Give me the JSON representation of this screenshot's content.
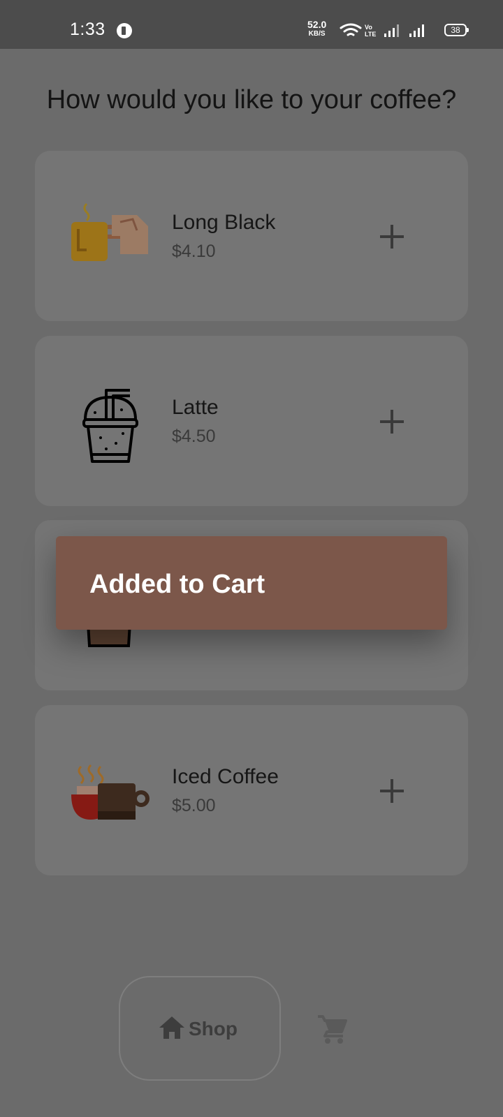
{
  "status_bar": {
    "time": "1:33",
    "net_speed_value": "52.0",
    "net_speed_unit": "KB/S",
    "volte": "Vo LTE",
    "battery": "38"
  },
  "heading": "How would you like to your coffee?",
  "products": [
    {
      "name": "Long Black",
      "price": "$4.10",
      "icon": "long-black-cup-icon"
    },
    {
      "name": "Latte",
      "price": "$4.50",
      "icon": "iced-cup-straw-icon"
    },
    {
      "name": "",
      "price": "",
      "icon": "cup-icon"
    },
    {
      "name": "Iced Coffee",
      "price": "$5.00",
      "icon": "coffee-mugs-icon"
    }
  ],
  "toast": {
    "message": "Added to Cart"
  },
  "bottom_nav": {
    "shop_label": "Shop",
    "shop_icon": "home-icon",
    "cart_icon": "cart-icon"
  },
  "colors": {
    "toast": "#7c574a",
    "scrim": "#6b6b6b",
    "card": "#757575"
  }
}
